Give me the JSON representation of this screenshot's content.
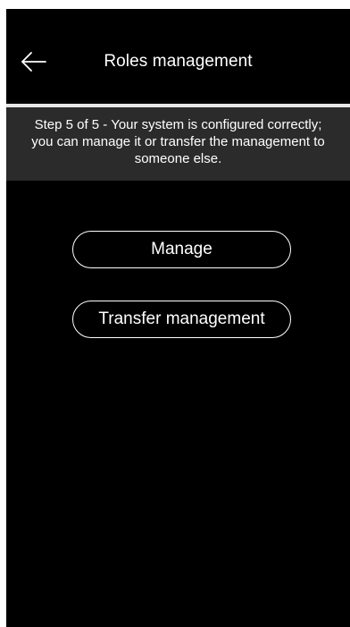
{
  "header": {
    "title": "Roles management",
    "back_icon": "arrow-left-icon"
  },
  "step_banner": {
    "text": "Step 5 of 5 -  Your system is configured correctly; you can manage it or transfer the management to someone else."
  },
  "actions": {
    "manage_label": "Manage",
    "transfer_label": "Transfer management"
  },
  "colors": {
    "background": "#000000",
    "banner": "#2b2b2b",
    "divider": "#e6e6e6",
    "text": "#ffffff"
  }
}
